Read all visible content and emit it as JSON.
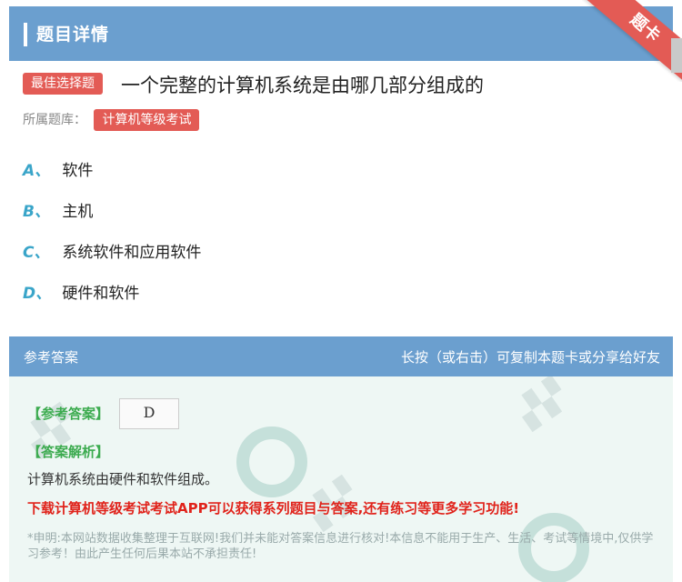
{
  "header": {
    "title": "题目详情"
  },
  "ribbon": {
    "label": "题卡"
  },
  "question": {
    "type_tag": "最佳选择题",
    "text": "一个完整的计算机系统是由哪几部分组成的",
    "bank_label": "所属题库：",
    "bank_tag": "计算机等级考试"
  },
  "options": [
    {
      "letter": "A、",
      "text": "软件"
    },
    {
      "letter": "B、",
      "text": "主机"
    },
    {
      "letter": "C、",
      "text": "系统软件和应用软件"
    },
    {
      "letter": "D、",
      "text": "硬件和软件"
    }
  ],
  "answer_section": {
    "title": "参考答案",
    "hint": "长按（或右击）可复制本题卡或分享给好友",
    "answer_label": "【参考答案】",
    "answer_value": "D",
    "analysis_label": "【答案解析】",
    "analysis_text": "计算机系统由硬件和软件组成。",
    "promo": "下载计算机等级考试考试APP可以获得系列题目与答案,还有练习等更多学习功能!",
    "disclaimer": "*申明:本网站数据收集整理于互联网!我们并未能对答案信息进行核对!本信息不能用于生产、生活、考试等情境中,仅供学习参考！由此产生任何后果本站不承担责任!"
  },
  "colors": {
    "header_bg": "#6b9fcf",
    "tag_red": "#e35b55",
    "option_letter": "#3aa5c9",
    "answer_green": "#3cab4f",
    "promo_red": "#e0231b"
  }
}
